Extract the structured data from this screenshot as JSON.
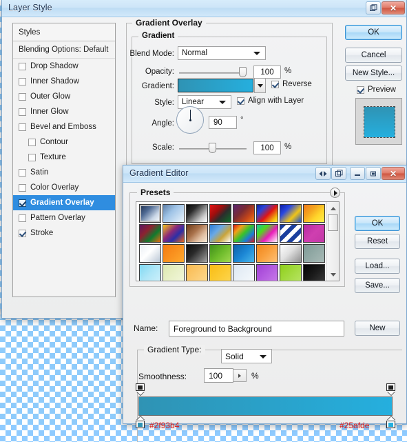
{
  "desktop": {
    "checker_color": "#8ecbfb"
  },
  "layer_style": {
    "title": "Layer Style",
    "titlebar_buttons": [
      {
        "name": "help-icon",
        "glyph": "◁▷"
      },
      {
        "name": "restore-icon",
        "glyph": "❐"
      },
      {
        "name": "close-icon",
        "glyph": "✕"
      }
    ],
    "styles_panel": {
      "header": "Styles",
      "blending_options": "Blending Options: Default",
      "items": [
        {
          "label": "Drop Shadow",
          "checked": false,
          "indent": false,
          "selected": false
        },
        {
          "label": "Inner Shadow",
          "checked": false,
          "indent": false,
          "selected": false
        },
        {
          "label": "Outer Glow",
          "checked": false,
          "indent": false,
          "selected": false
        },
        {
          "label": "Inner Glow",
          "checked": false,
          "indent": false,
          "selected": false
        },
        {
          "label": "Bevel and Emboss",
          "checked": false,
          "indent": false,
          "selected": false
        },
        {
          "label": "Contour",
          "checked": false,
          "indent": true,
          "selected": false
        },
        {
          "label": "Texture",
          "checked": false,
          "indent": true,
          "selected": false
        },
        {
          "label": "Satin",
          "checked": false,
          "indent": false,
          "selected": false
        },
        {
          "label": "Color Overlay",
          "checked": false,
          "indent": false,
          "selected": false
        },
        {
          "label": "Gradient Overlay",
          "checked": true,
          "indent": false,
          "selected": true
        },
        {
          "label": "Pattern Overlay",
          "checked": false,
          "indent": false,
          "selected": false
        },
        {
          "label": "Stroke",
          "checked": true,
          "indent": false,
          "selected": false
        }
      ]
    },
    "gradient_overlay": {
      "group_title": "Gradient Overlay",
      "sub_group_title": "Gradient",
      "blend_mode_label": "Blend Mode:",
      "blend_mode_value": "Normal",
      "opacity_label": "Opacity:",
      "opacity_value": "100",
      "opacity_unit": "%",
      "gradient_label": "Gradient:",
      "gradient_start": "#2f93b4",
      "gradient_end": "#25afde",
      "reverse_label": "Reverse",
      "reverse_checked": true,
      "style_label": "Style:",
      "style_value": "Linear",
      "align_label": "Align with Layer",
      "align_checked": true,
      "angle_label": "Angle:",
      "angle_value": "90",
      "angle_unit": "°",
      "scale_label": "Scale:",
      "scale_value": "100",
      "scale_unit": "%"
    },
    "buttons": {
      "ok": "OK",
      "cancel": "Cancel",
      "new_style": "New Style...",
      "preview_label": "Preview",
      "preview_checked": true
    }
  },
  "gradient_editor": {
    "title": "Gradient Editor",
    "titlebar_buttons": [
      {
        "name": "resize-icon",
        "glyph": "◁▷"
      },
      {
        "name": "restore-icon",
        "glyph": "❐"
      },
      {
        "name": "minimize-icon",
        "glyph": "–"
      },
      {
        "name": "maximize-icon",
        "glyph": "□"
      },
      {
        "name": "close-icon",
        "glyph": "✕"
      }
    ],
    "presets_label": "Presets",
    "presets": [
      "linear-gradient(135deg,#1b2b4a 0%,#4f6a93 35%,#c9d6e6 70%,#ffffff 100%)",
      "linear-gradient(135deg,#5e7fa8 0%,#9fc3e6 40%,#e9f3fb 100%)",
      "linear-gradient(135deg,#0a0a0a 0%,#2b2b2b 30%,#c9c9c9 75%,#ffffff 100%)",
      "linear-gradient(135deg,#e21414 0%,#a10d0d 35%,#2c2c2c 60%,#0f6b2a 100%)",
      "linear-gradient(135deg,#5a2470 0%,#7a2b33 40%,#c2451a 70%,#f07f1b 100%)",
      "linear-gradient(135deg,#10219b 0%,#2a44d8 25%,#e01515 55%,#f4c310 85%,#ffe94f 100%)",
      "linear-gradient(135deg,#0f1fa8 0%,#2a49e0 30%,#f0c518 65%,#1b4fd0 100%)",
      "linear-gradient(135deg,#f07a1a 0%,#f4a41f 35%,#ffd52b 65%,#fff04a 100%)",
      "linear-gradient(135deg,#5b1860 0%,#8c2230 35%,#0f7a2e 65%,#e86a14 100%)",
      "linear-gradient(135deg,#f4c41a 0%,#8c2a78 40%,#2a2fa8 65%,#e8661a 100%)",
      "linear-gradient(135deg,#6b3a1a 0%,#a9714a 40%,#e0bda0 70%,#f7ead9 100%)",
      "linear-gradient(135deg,#2a7ad4 0%,#6aa9e6 35%,#c9a43a 65%,#ffffff 100%)",
      "linear-gradient(135deg,#d81616 0%,#f2a01a 25%,#39c22a 50%,#1b7ad8 75%,#d81616 100%)",
      "linear-gradient(135deg,#16c2a8 0%,#4fd81b 30%,#e81bb8 60%,#ffffff 100%)",
      "repeating-linear-gradient(135deg,#1b3f9e 0 6px,#ffffff 6px 12px)",
      "linear-gradient(135deg,#b52aa0 0%,#cf3fb0 50%,#c238a6 100%)",
      "linear-gradient(135deg,#e9eef4 0%,#ffffff 45%,#b9c6d4 100%)",
      "linear-gradient(135deg,#f47a12 0%,#f9911f 50%,#ffa92e 100%)",
      "linear-gradient(135deg,#0d0d0d 0%,#2a2a2a 40%,#6f6f6f 75%,#a8a8a8 100%)",
      "linear-gradient(135deg,#3f8f1b 0%,#6cba2a 50%,#9fd84f 100%)",
      "linear-gradient(135deg,#0f5fa8 0%,#1b86d4 50%,#49b6ea 100%)",
      "linear-gradient(135deg,#f0841a 0%,#f9a13f 50%,#ffc177 100%)",
      "linear-gradient(135deg,#ffffff 0%,#e0e0e0 45%,#8f8f8f 100%)",
      "linear-gradient(135deg,#7e9a96 0%,#93aaa6 50%,#a8bab6 100%)",
      "linear-gradient(135deg,#7fd8f2 0%,#aee6f7 50%,#cdf0fb 100%)",
      "linear-gradient(135deg,#dde8b0 0%,#e8f0c6 50%,#f2f7da 100%)",
      "linear-gradient(135deg,#f9b94f 0%,#fbc96e 50%,#fdd98e 100%)",
      "linear-gradient(135deg,#f9bc14 0%,#fbc92f 50%,#fdd64f 100%)",
      "linear-gradient(135deg,#dce7f2 0%,#e9f0f7 50%,#f5f9fc 100%)",
      "linear-gradient(135deg,#a03fd4 0%,#b45ce0 50%,#c87aea 100%)",
      "linear-gradient(135deg,#8fcf1b 0%,#a3da3f 50%,#b7e463 100%)",
      "linear-gradient(135deg,#050505 0%,#1a1a1a 50%,#3a3a3a 100%)"
    ],
    "name_label": "Name:",
    "name_value": "Foreground to Background",
    "new_button": "New",
    "gradient_type_label": "Gradient Type:",
    "gradient_type_value": "Solid",
    "smoothness_label": "Smoothness:",
    "smoothness_value": "100",
    "smoothness_unit": "%",
    "bar_start_color": "#2f93b4",
    "bar_end_color": "#25afde",
    "stop_left_hex": "#2f93b4",
    "stop_right_hex": "#25afde",
    "buttons": {
      "ok": "OK",
      "reset": "Reset",
      "load": "Load...",
      "save": "Save..."
    }
  }
}
